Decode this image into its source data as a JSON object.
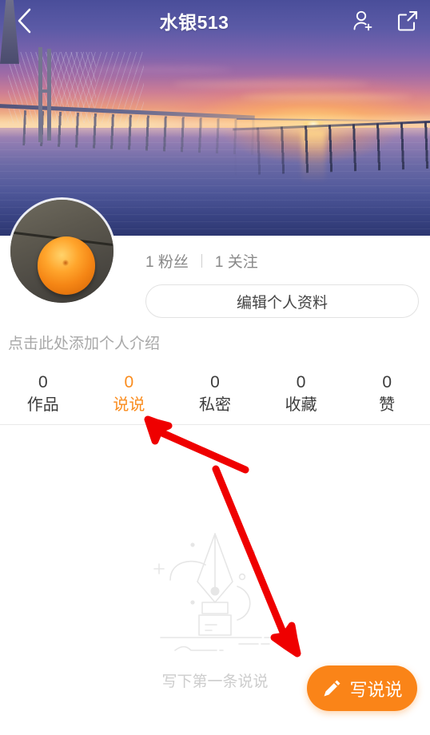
{
  "header": {
    "title": "水银513",
    "back_icon": "chevron-left-icon",
    "add_user_icon": "add-user-icon",
    "share_icon": "share-external-icon"
  },
  "cover": {
    "alt": "sunset bridge over calm water"
  },
  "profile": {
    "avatar_alt": "orange fruit on wooden table",
    "followers_count": "1",
    "followers_label": "粉丝",
    "separator": "|",
    "following_count": "1",
    "following_label": "关注",
    "edit_profile_label": "编辑个人资料",
    "intro_placeholder": "点击此处添加个人介绍"
  },
  "tabs": [
    {
      "count": "0",
      "label": "作品",
      "active": false
    },
    {
      "count": "0",
      "label": "说说",
      "active": true
    },
    {
      "count": "0",
      "label": "私密",
      "active": false
    },
    {
      "count": "0",
      "label": "收藏",
      "active": false
    },
    {
      "count": "0",
      "label": "赞",
      "active": false
    }
  ],
  "empty_state": {
    "illustration": "fountain-pen-nib-icon",
    "text": "写下第一条说说"
  },
  "fab": {
    "icon": "pencil-icon",
    "label": "写说说"
  },
  "annotations": {
    "arrow_color": "#ef0000",
    "arrow_count": 2
  },
  "colors": {
    "accent": "#fa8c1e",
    "fab": "#fa8418",
    "text_primary": "#3c3c3c",
    "text_muted": "#888888",
    "text_placeholder": "#a8a8a8",
    "empty_text": "#cdcdcd",
    "divider": "#e9e9e9"
  }
}
